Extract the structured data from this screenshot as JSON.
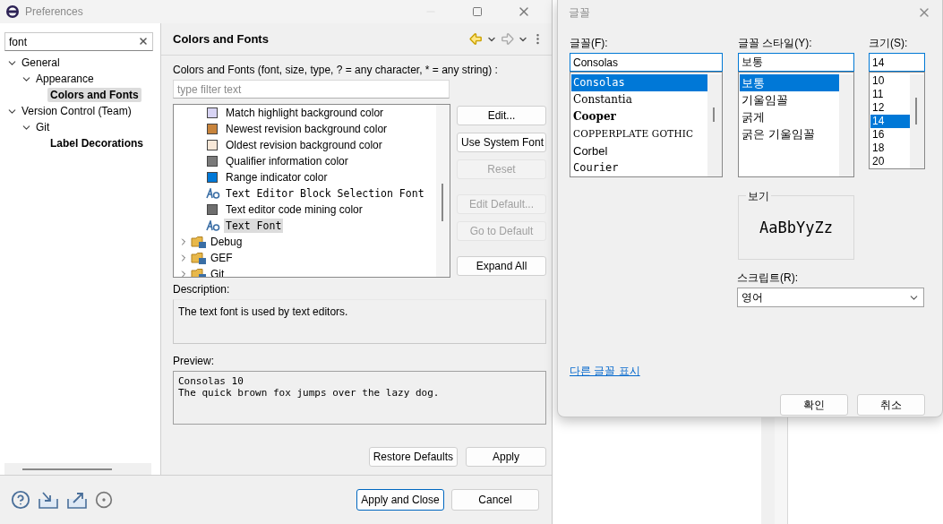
{
  "preferences": {
    "title": "Preferences",
    "search": {
      "value": "font"
    },
    "tree": [
      {
        "label": "General",
        "expanded": true,
        "selected": false,
        "matched": false,
        "children": [
          {
            "label": "Appearance",
            "expanded": true,
            "selected": false,
            "matched": false,
            "children": [
              {
                "label": "Colors and Fonts",
                "selected": true,
                "matched": true
              }
            ]
          }
        ]
      },
      {
        "label": "Version Control (Team)",
        "expanded": true,
        "selected": false,
        "matched": false,
        "children": [
          {
            "label": "Git",
            "expanded": true,
            "selected": false,
            "matched": false,
            "children": [
              {
                "label": "Label Decorations",
                "selected": false,
                "matched": true
              }
            ]
          }
        ]
      }
    ],
    "page_title": "Colors and Fonts",
    "filter_label": "Colors and Fonts (font, size, type, ? = any character, * = any string) :",
    "filter": {
      "placeholder": "type filter text"
    },
    "items": [
      {
        "kind": "color",
        "label": "Match highlight background color",
        "color": "#d8d4f4",
        "selected": false
      },
      {
        "kind": "color",
        "label": "Newest revision background color",
        "color": "#c8843c",
        "selected": false
      },
      {
        "kind": "color",
        "label": "Oldest revision background color",
        "color": "#f8e8d8",
        "selected": false
      },
      {
        "kind": "color",
        "label": "Qualifier information color",
        "color": "#7a7a7a",
        "selected": false
      },
      {
        "kind": "color",
        "label": "Range indicator color",
        "color": "#0078d7",
        "selected": false
      },
      {
        "kind": "font",
        "label": "Text Editor Block Selection Font",
        "selected": false
      },
      {
        "kind": "color",
        "label": "Text editor code mining color",
        "color": "#6e6e6e",
        "selected": false
      },
      {
        "kind": "font",
        "label": "Text Font",
        "selected": true
      },
      {
        "kind": "category",
        "label": "Debug",
        "expanded": false,
        "selected": false
      },
      {
        "kind": "category",
        "label": "GEF",
        "expanded": false,
        "selected": false
      },
      {
        "kind": "category",
        "label": "Git",
        "expanded": false,
        "selected": false
      }
    ],
    "side_buttons": [
      {
        "label": "Edit...",
        "disabled": false
      },
      {
        "label": "Use System Font",
        "disabled": false
      },
      {
        "label": "Reset",
        "disabled": true
      },
      {
        "label": "Edit Default...",
        "disabled": true
      },
      {
        "label": "Go to Default",
        "disabled": true
      },
      {
        "label": "Expand All",
        "disabled": false
      }
    ],
    "description_label": "Description:",
    "description": "The text font is used by text editors.",
    "preview_label": "Preview:",
    "preview_lines": [
      "Consolas 10",
      "The quick brown fox jumps over the lazy dog."
    ],
    "page_buttons": [
      "Restore Defaults",
      "Apply"
    ],
    "footer_buttons": [
      {
        "label": "Apply and Close",
        "default": true
      },
      {
        "label": "Cancel",
        "default": false
      }
    ]
  },
  "font_dialog": {
    "title": "글꼴",
    "font": {
      "label": "글꼴(F):",
      "value": "Consolas",
      "options": [
        {
          "label": "Consolas",
          "kind": "mono",
          "selected": true
        },
        {
          "label": "Constantia",
          "kind": "serif",
          "selected": false
        },
        {
          "label": "Cooper",
          "kind": "heavy",
          "selected": false
        },
        {
          "label": "COPPERPLATE GOTHIC",
          "kind": "wide",
          "selected": false
        },
        {
          "label": "Corbel",
          "kind": "sans",
          "selected": false
        },
        {
          "label": "Courier",
          "kind": "mono",
          "selected": false
        }
      ]
    },
    "style": {
      "label": "글꼴 스타일(Y):",
      "value": "보통",
      "options": [
        {
          "label": "보통",
          "selected": true
        },
        {
          "label": "기울임꼴",
          "selected": false
        },
        {
          "label": "굵게",
          "selected": false
        },
        {
          "label": "굵은 기울임꼴",
          "selected": false
        }
      ]
    },
    "size": {
      "label": "크기(S):",
      "value": "14",
      "options": [
        {
          "label": "10",
          "selected": false
        },
        {
          "label": "11",
          "selected": false
        },
        {
          "label": "12",
          "selected": false
        },
        {
          "label": "14",
          "selected": true
        },
        {
          "label": "16",
          "selected": false
        },
        {
          "label": "18",
          "selected": false
        },
        {
          "label": "20",
          "selected": false
        }
      ]
    },
    "sample_label": "보기",
    "sample": "AaBbYyZz",
    "script_label": "스크립트(R):",
    "script": "영어",
    "more_fonts_link": "다른 글꼴 표시",
    "buttons": [
      "확인",
      "취소"
    ]
  }
}
